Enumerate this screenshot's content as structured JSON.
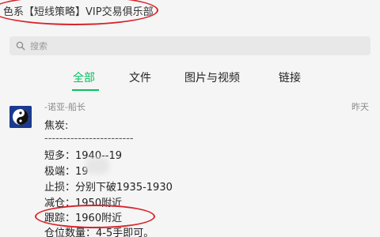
{
  "window": {
    "title": "色系【短线策略】VIP交易俱乐部"
  },
  "search": {
    "placeholder": "搜索"
  },
  "tabs": [
    {
      "label": "全部",
      "active": true
    },
    {
      "label": "文件",
      "active": false
    },
    {
      "label": "图片与视频",
      "active": false
    },
    {
      "label": "链接",
      "active": false
    }
  ],
  "message": {
    "sender": "-诺亚-船长",
    "time": "昨天",
    "lines": [
      "焦炭:",
      "------------------------",
      "短多：1940--19",
      "极端：19",
      "止损：分别下破1935-1930",
      "减仓：1950附近",
      "跟踪：1960附近",
      "仓位数量：4-5手即可。"
    ]
  },
  "colors": {
    "accent": "#07c160",
    "annotation": "#d8232a",
    "avatar_bg": "#1b3a8f"
  }
}
